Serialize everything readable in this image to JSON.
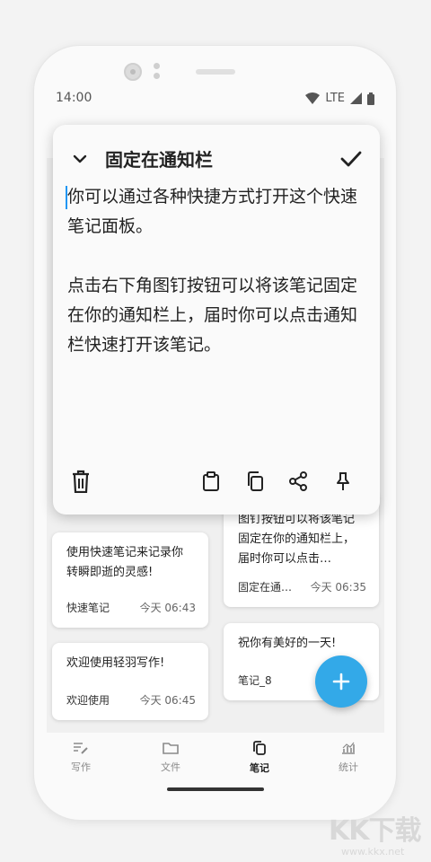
{
  "status_bar": {
    "time": "14:00",
    "network": "LTE"
  },
  "panel": {
    "title": "固定在通知栏",
    "text": "你可以通过各种快捷方式打开这个快速笔记面板。\n\n点击右下角图钉按钮可以将该笔记固定在你的通知栏上，届时你可以点击通知栏快速打开该笔记。"
  },
  "notes": [
    {
      "body": "使用快速笔记来记录你转瞬即逝的灵感!",
      "title": "快速笔记",
      "date": "今天 06:43"
    },
    {
      "body": "欢迎使用轻羽写作!",
      "title": "欢迎使用",
      "date": "今天 06:45"
    },
    {
      "body": "图钉按钮可以将该笔记固定在你的通知栏上，届时你可以点击…",
      "title": "固定在通…",
      "date": "今天 06:35"
    },
    {
      "body": "祝你有美好的一天!",
      "title": "笔记_8",
      "date": "今"
    }
  ],
  "nav": [
    {
      "label": "写作",
      "icon": "edit-note-icon"
    },
    {
      "label": "文件",
      "icon": "folder-icon"
    },
    {
      "label": "笔记",
      "icon": "notes-icon",
      "active": true
    },
    {
      "label": "统计",
      "icon": "stats-icon"
    }
  ],
  "watermark": {
    "logo": "KK下载",
    "url": "www.kkx.net"
  },
  "colors": {
    "accent": "#33a9e8",
    "caret": "#2196f3"
  }
}
